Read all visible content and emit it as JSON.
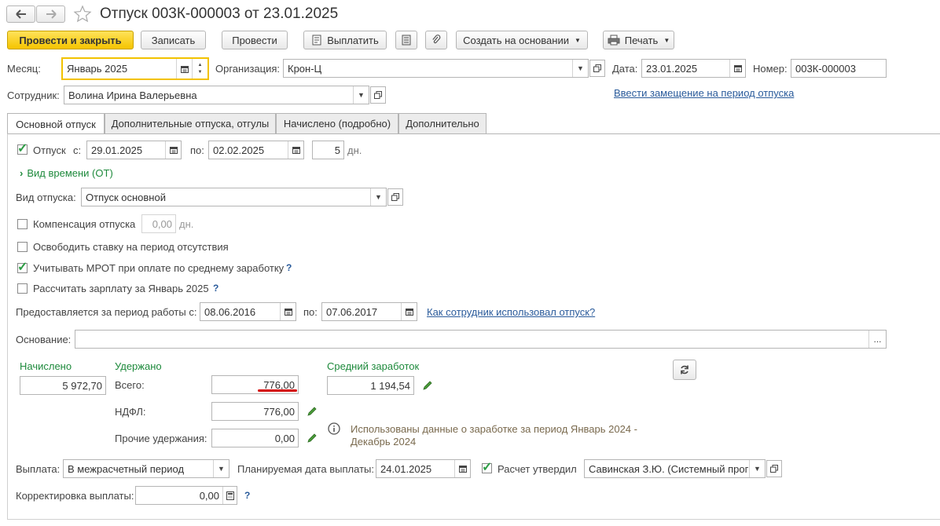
{
  "window": {
    "title": "Отпуск 003К-000003 от 23.01.2025",
    "nav_back_icon": "arrow-left-icon",
    "nav_forward_icon": "arrow-right-icon",
    "star_icon": "star-icon"
  },
  "toolbar": {
    "post_and_close": "Провести и закрыть",
    "save": "Записать",
    "post": "Провести",
    "pay": "Выплатить",
    "create_based_on": "Создать на основании",
    "print": "Печать"
  },
  "header": {
    "month_label": "Месяц:",
    "month_value": "Январь 2025",
    "org_label": "Организация:",
    "org_value": "Крон-Ц",
    "date_label": "Дата:",
    "date_value": "23.01.2025",
    "number_label": "Номер:",
    "number_value": "003К-000003",
    "employee_label": "Сотрудник:",
    "employee_value": "Волина Ирина Валерьевна",
    "substitution_link": "Ввести замещение на период отпуска"
  },
  "tabs": [
    {
      "label": "Основной отпуск"
    },
    {
      "label": "Дополнительные отпуска, отгулы"
    },
    {
      "label": "Начислено (подробно)"
    },
    {
      "label": "Дополнительно"
    }
  ],
  "main": {
    "vacation_checkbox_label": "Отпуск",
    "from_label": "с:",
    "from_value": "29.01.2025",
    "to_label": "по:",
    "to_value": "02.02.2025",
    "days_value": "5",
    "days_unit": "дн.",
    "time_type_label": "Вид времени (ОТ)",
    "vacation_type_label": "Вид отпуска:",
    "vacation_type_value": "Отпуск основной",
    "compensation_label": "Компенсация отпуска",
    "compensation_value": "0,00",
    "compensation_unit": "дн.",
    "free_rate_label": "Освободить ставку на период отсутствия",
    "mrot_label": "Учитывать МРОТ при оплате по среднему заработку",
    "calc_salary_label": "Рассчитать зарплату за Январь 2025",
    "period_label": "Предоставляется за период работы с:",
    "period_from": "08.06.2016",
    "period_to_label": "по:",
    "period_to": "07.06.2017",
    "how_used_link": "Как сотрудник использовал отпуск?",
    "basis_label": "Основание:",
    "basis_value": "",
    "basis_button": "...",
    "help_mark": "?"
  },
  "totals": {
    "accrued_label": "Начислено",
    "accrued_value": "5 972,70",
    "withheld_label": "Удержано",
    "total_label": "Всего:",
    "total_value": "776,00",
    "ndfl_label": "НДФЛ:",
    "ndfl_value": "776,00",
    "other_label": "Прочие удержания:",
    "other_value": "0,00",
    "avg_label": "Средний заработок",
    "avg_value": "1 194,54",
    "info_text_1": "Использованы данные о заработке за период Январь 2024 -",
    "info_text_2": "Декабрь 2024"
  },
  "payment": {
    "payment_label": "Выплата:",
    "payment_value": "В межрасчетный период",
    "planned_label": "Планируемая дата выплаты:",
    "planned_value": "24.01.2025",
    "approved_label": "Расчет утвердил",
    "approved_value": "Савинская З.Ю. (Системный прог",
    "correction_label": "Корректировка выплаты:",
    "correction_value": "0,00"
  },
  "colors": {
    "accent_yellow": "#f5c400",
    "green": "#1e8a3c",
    "link": "#2a5b9b",
    "underline_red": "#d40000"
  }
}
